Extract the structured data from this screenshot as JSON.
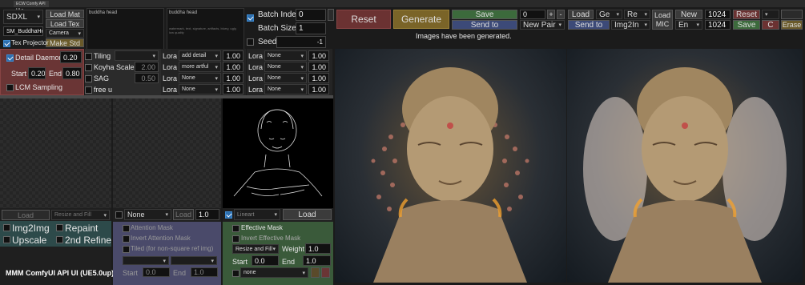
{
  "window": {
    "tab_title": "ECW Comfy API UI",
    "close_glyph": "×"
  },
  "model": {
    "selected": "SDXL",
    "load_mat": "Load Mat",
    "load_tex": "Load Tex",
    "make_std": "Make Std",
    "camera": "Camera",
    "prompt_name": "SM_BuddhaHe",
    "tex_projector": "Tex Projector"
  },
  "prompts": {
    "positive": "buddha head",
    "negative_top": "buddha head",
    "negative_detail": "watermark, text, signature, artifacts, blurry, ugly, low quality"
  },
  "batch": {
    "index_label": "Batch Index",
    "index_value": "0",
    "size_label": "Batch Size",
    "size_value": "1",
    "seed_label": "Seed",
    "seed_value": "-1"
  },
  "actions": {
    "reset": "Reset",
    "generate": "Generate",
    "save": "Save",
    "send_to": "Send to",
    "new_pair": "New Pair",
    "counter": "0",
    "plus": "+",
    "minus": "-",
    "load": "Load",
    "ge": "Ge",
    "re": "Re",
    "send_to2": "Send to",
    "img2img": "Img2In",
    "load_mic": "Load MIC",
    "new": "New",
    "en": "En",
    "w": "1024",
    "h": "1024",
    "reset2": "Reset",
    "save2": "Save",
    "c": "C",
    "erase": "Erase"
  },
  "status": "Images have been generated.",
  "detail": {
    "daemon_label": "Detail Daemon",
    "daemon_value": "0.20",
    "start_label": "Start",
    "start_value": "0.20",
    "end_label": "End",
    "end_value": "0.80",
    "lcm": "LCM Sampling"
  },
  "tiling": {
    "label": "Tiling",
    "koyha": "Koyha Scale",
    "koyha_value": "2.00",
    "sag": "SAG",
    "sag_value": "0.50",
    "freeu": "free u"
  },
  "loras_a": [
    {
      "label": "Lora",
      "name": "add detail",
      "value": "1.00"
    },
    {
      "label": "Lora",
      "name": "more artful",
      "value": "1.00"
    },
    {
      "label": "Lora",
      "name": "None",
      "value": "1.00"
    },
    {
      "label": "Lora",
      "name": "None",
      "value": "1.00"
    }
  ],
  "loras_b": [
    {
      "label": "Lora",
      "name": "None",
      "value": "1.00"
    },
    {
      "label": "Lora",
      "name": "None",
      "value": "1.00"
    },
    {
      "label": "Lora",
      "name": "None",
      "value": "1.00"
    },
    {
      "label": "Lora",
      "name": "None",
      "value": "1.00"
    }
  ],
  "bottom_left": {
    "load": "Load",
    "resize": "Resize and Fill",
    "img2img": "Img2Img",
    "repaint": "Repaint",
    "upscale": "Upscale",
    "refine": "2nd Refine",
    "footer": "MMM ComfyUI API UI (UE5.0up)"
  },
  "attention": {
    "select": "None",
    "load": "Load",
    "value": "1.0",
    "mask": "Attention Mask",
    "invert": "Invert Attention Mask",
    "tiled": "Tiled (for non-square ref img)",
    "start_label": "Start",
    "start_value": "0.0",
    "end_label": "End",
    "end_value": "1.0"
  },
  "controlnet": {
    "type": "Lineart",
    "load": "Load",
    "effective_mask": "Effective Mask",
    "invert_effective": "Invert Effective Mask",
    "resize": "Resize and Fill",
    "weight_label": "Weight",
    "weight_value": "1.0",
    "start_label": "Start",
    "start_value": "0.0",
    "end_label": "End",
    "end_value": "1.0",
    "model": "none"
  },
  "colors": {
    "reset": "#6b3232",
    "generate": "#7a6428",
    "save": "#3c6a3c",
    "send": "#3c4a78",
    "accent": "#2d6fb0"
  }
}
